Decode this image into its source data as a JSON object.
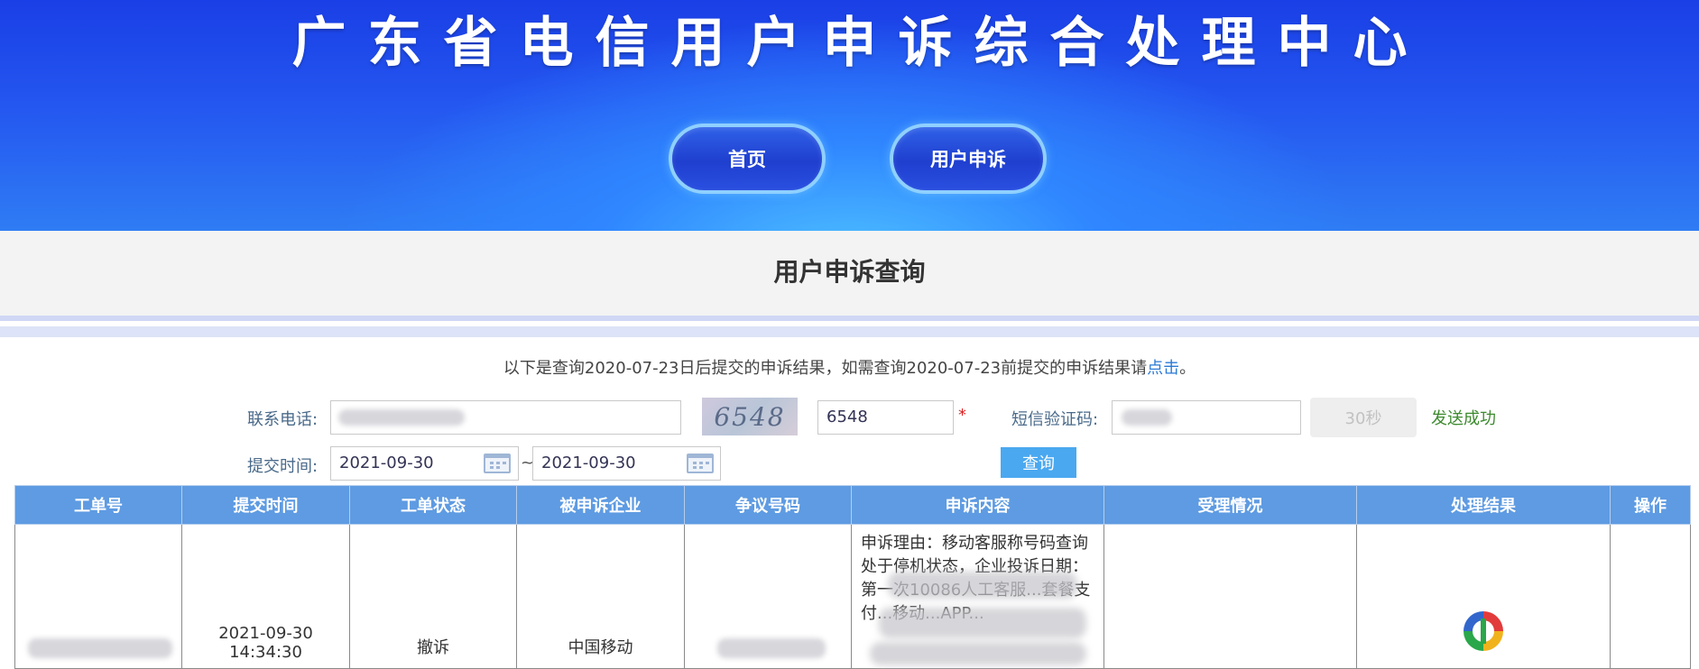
{
  "header": {
    "site_title": "广东省电信用户申诉综合处理中心",
    "nav": [
      {
        "label": "首页"
      },
      {
        "label": "用户申诉"
      }
    ]
  },
  "page_title": "用户申诉查询",
  "notice": {
    "text_before": "以下是查询2020-07-23日后提交的申诉结果，如需查询2020-07-23前提交的申诉结果请",
    "link_text": "点击",
    "text_after": "。"
  },
  "form": {
    "phone_label": "联系电话:",
    "phone_value": "",
    "captcha_text": "6548",
    "captcha_value": "6548",
    "required_mark": "*",
    "sms_label": "短信验证码:",
    "sms_value": "",
    "countdown_label": "30秒",
    "send_status": "发送成功",
    "time_label": "提交时间:",
    "date_from": "2021-09-30",
    "date_to": "2021-09-30",
    "range_separator": "~",
    "query_button": "查询"
  },
  "table": {
    "columns": [
      "工单号",
      "提交时间",
      "工单状态",
      "被申诉企业",
      "争议号码",
      "申诉内容",
      "受理情况",
      "处理结果",
      "操作"
    ],
    "rows": [
      {
        "order_no": "",
        "submit_date": "2021-09-30",
        "submit_time": "14:34:30",
        "status": "撤诉",
        "company": "中国移动",
        "disputed_number": "",
        "content": "申诉理由：移动客服称号码查询处于停机状态，企业投诉日期：第一次10086人工客服...套餐支付...移动...APP...",
        "acceptance": "",
        "result": "",
        "action": ""
      }
    ]
  },
  "colors": {
    "header_blue": "#2456f0",
    "table_header": "#5e9be2",
    "link": "#2a7ad6",
    "success": "#3c8a2e",
    "query_button": "#4aa8f0"
  }
}
